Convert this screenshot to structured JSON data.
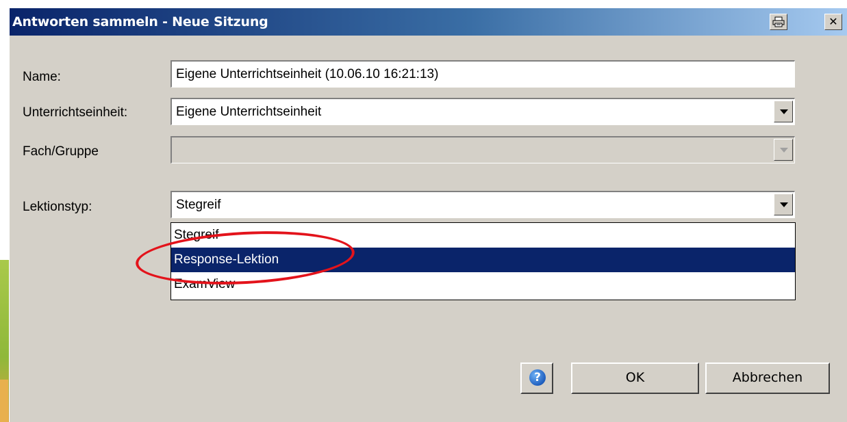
{
  "window": {
    "title": "Antworten sammeln - Neue Sitzung",
    "print_icon": "printer-icon",
    "close_glyph": "✕"
  },
  "form": {
    "name_label": "Name:",
    "name_value": "Eigene Unterrichtseinheit (10.06.10 16:21:13)",
    "unit_label": "Unterrichtseinheit:",
    "unit_value": "Eigene Unterrichtseinheit",
    "subject_label": "Fach/Gruppe",
    "subject_value": "",
    "lesson_type_label": "Lektionstyp:",
    "lesson_type_value": "Stegreif"
  },
  "lesson_type_options": [
    {
      "label": "Stegreif",
      "selected": false
    },
    {
      "label": "Response-Lektion",
      "selected": true
    },
    {
      "label": "ExamView",
      "selected": false
    }
  ],
  "buttons": {
    "help_glyph": "?",
    "ok": "OK",
    "cancel": "Abbrechen"
  },
  "colors": {
    "titlebar_start": "#0a246a",
    "titlebar_end": "#a6caf0",
    "selection": "#0a246a",
    "annotation": "#e3131b",
    "dialog_bg": "#d4d0c8"
  }
}
